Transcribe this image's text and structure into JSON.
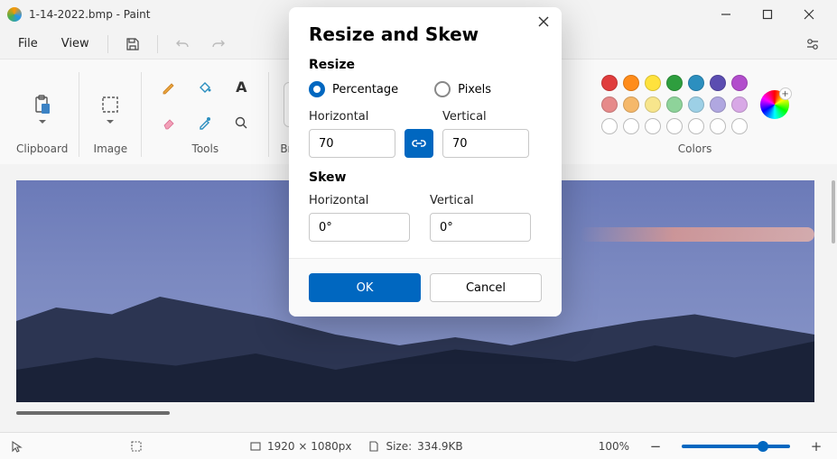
{
  "titlebar": {
    "filename": "1-14-2022.bmp",
    "app": "Paint",
    "full_title": "1-14-2022.bmp - Paint"
  },
  "menu": {
    "file": "File",
    "view": "View"
  },
  "ribbon": {
    "clipboard_label": "Clipboard",
    "image_label": "Image",
    "tools_label": "Tools",
    "brushes_label": "Brushes",
    "colors_label": "Colors",
    "swatches_row1": [
      "#e03c3c",
      "#ff8c1a",
      "#ffe23d",
      "#2e9e3e",
      "#2c8fbf",
      "#5b4db1",
      "#b24dcc"
    ],
    "swatches_row2": [
      "#e68a8a",
      "#f5b86a",
      "#f7e58c",
      "#8ed39a",
      "#9dd0e6",
      "#b0a7e0",
      "#d8a8e6"
    ]
  },
  "dialog": {
    "title": "Resize and Skew",
    "resize_heading": "Resize",
    "percentage_label": "Percentage",
    "pixels_label": "Pixels",
    "resize_mode": "percentage",
    "horizontal_label": "Horizontal",
    "vertical_label": "Vertical",
    "resize_h": "70",
    "resize_v": "70",
    "aspect_locked": true,
    "skew_heading": "Skew",
    "skew_h_label": "Horizontal",
    "skew_v_label": "Vertical",
    "skew_h": "0°",
    "skew_v": "0°",
    "ok": "OK",
    "cancel": "Cancel"
  },
  "statusbar": {
    "dimensions": "1920 × 1080px",
    "size_label": "Size:",
    "size_value": "334.9KB",
    "zoom": "100%"
  }
}
